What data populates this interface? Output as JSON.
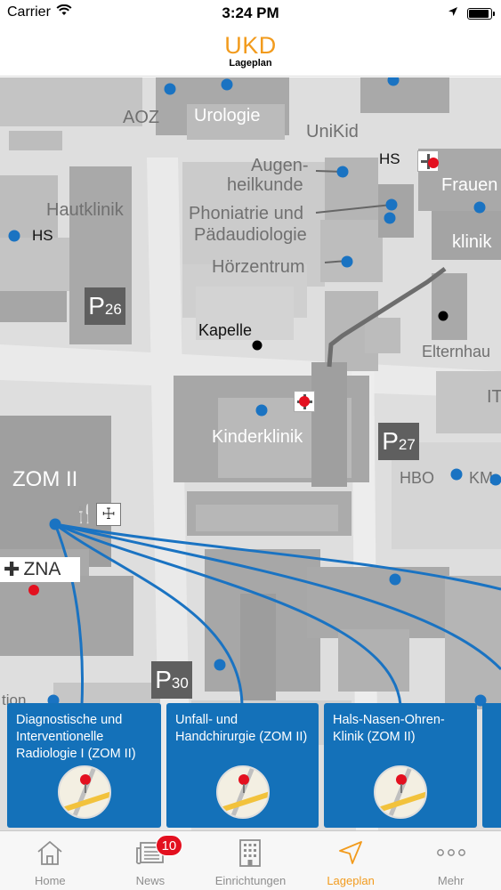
{
  "status_bar": {
    "carrier": "Carrier",
    "time": "3:24 PM",
    "battery_level": 0.95,
    "icons": [
      "wifi-icon",
      "location-arrow-icon",
      "battery-icon"
    ]
  },
  "header": {
    "logo_main": "UKD",
    "logo_sub": "Lageplan"
  },
  "map": {
    "labels": {
      "aoz": "AOZ",
      "urologie": "Urologie",
      "unikid": "UniKid",
      "augen1": "Augen-",
      "augen2": "heilkunde",
      "hs_top": "HS",
      "frauen": "Frauen",
      "hautklinik": "Hautklinik",
      "hs_left": "HS",
      "phoniatrie1": "Phoniatrie und",
      "phoniatrie2": "Pädaudiologie",
      "klinik": "klinik",
      "hoerzentrum": "Hörzentrum",
      "kapelle": "Kapelle",
      "elternhaus": "Elternhau",
      "it": "IT",
      "kinderklinik": "Kinderklinik",
      "zom2": "ZOM II",
      "hbo": "HBO",
      "km": "KM",
      "zna": "ZNA",
      "tion": "tion"
    },
    "parking": [
      {
        "letter": "P",
        "num": "26"
      },
      {
        "letter": "P",
        "num": "27"
      },
      {
        "letter": "P",
        "num": "30"
      }
    ]
  },
  "cards": [
    {
      "title": "Diagnostische und Interventionelle Radiologie I (ZOM II)"
    },
    {
      "title": "Unfall- und Handchirurgie (ZOM II)"
    },
    {
      "title": "Hals-Nasen-Ohren-Klinik (ZOM II)"
    }
  ],
  "tabbar": {
    "tabs": [
      {
        "label": "Home",
        "icon": "house-icon"
      },
      {
        "label": "News",
        "icon": "newspaper-icon",
        "badge": "10"
      },
      {
        "label": "Einrichtungen",
        "icon": "building-icon"
      },
      {
        "label": "Lageplan",
        "icon": "navigation-arrow-icon",
        "active": true
      },
      {
        "label": "Mehr",
        "icon": "more-dots-icon"
      }
    ]
  },
  "colors": {
    "accent": "#f29b1d",
    "card_blue": "#1471b9",
    "marker_blue": "#1a73c2",
    "marker_red": "#e3101f"
  }
}
